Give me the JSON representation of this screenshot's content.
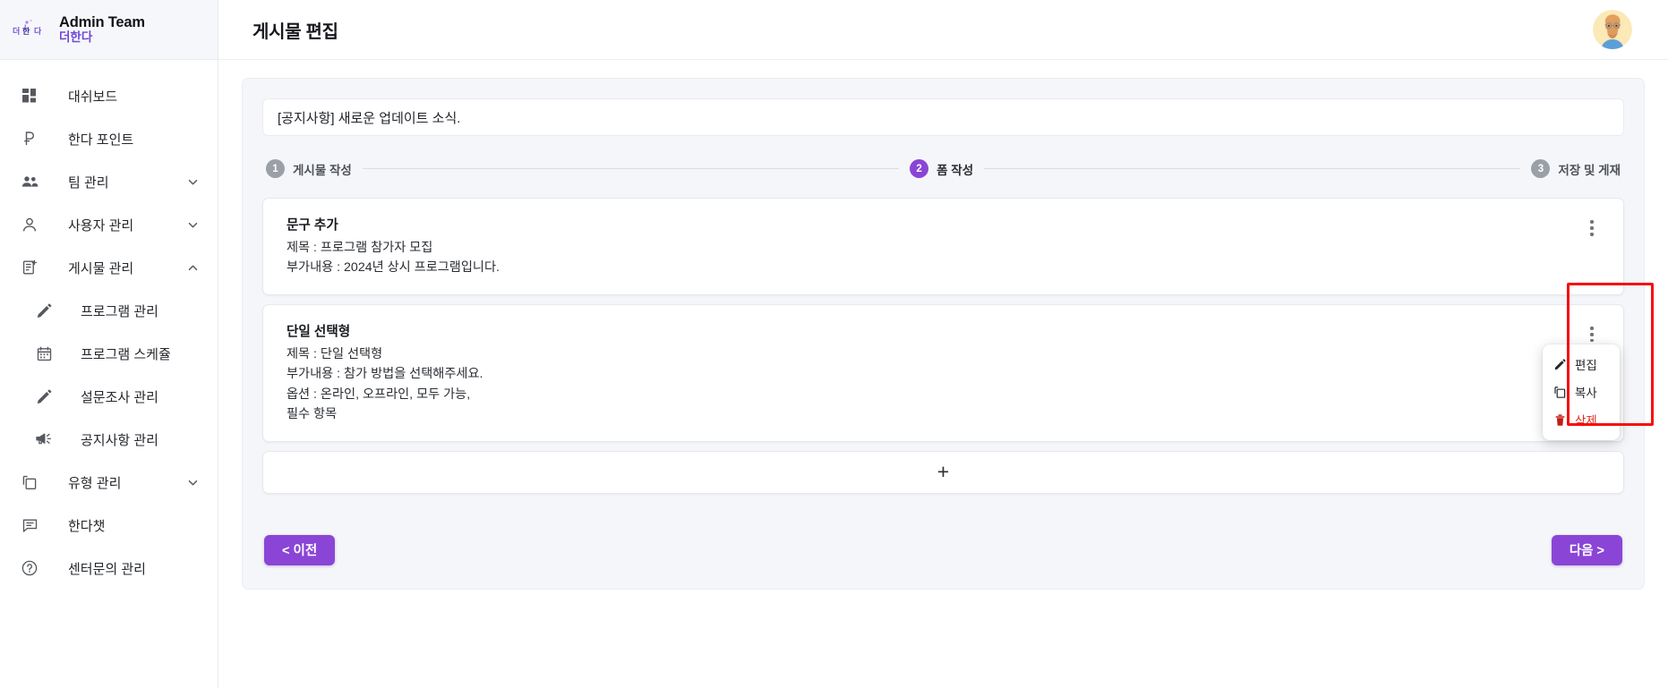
{
  "brand": {
    "logo_icon": "hanada-logo-icon",
    "title": "Admin Team",
    "subtitle": "더한다"
  },
  "sidebar": {
    "items": [
      {
        "label": "대쉬보드",
        "icon": "dashboard-grid-icon",
        "expandable": false,
        "sub": false
      },
      {
        "label": "한다 포인트",
        "icon": "point-currency-icon",
        "expandable": false,
        "sub": false
      },
      {
        "label": "팀 관리",
        "icon": "people-group-icon",
        "expandable": true,
        "sub": false
      },
      {
        "label": "사용자 관리",
        "icon": "person-icon",
        "expandable": true,
        "sub": false
      },
      {
        "label": "게시물 관리",
        "icon": "post-add-icon",
        "expandable": true,
        "expanded": true,
        "sub": false
      },
      {
        "label": "프로그램 관리",
        "icon": "pencil-icon",
        "expandable": false,
        "sub": true
      },
      {
        "label": "프로그램 스케쥴",
        "icon": "calendar-icon",
        "expandable": false,
        "sub": true
      },
      {
        "label": "설문조사 관리",
        "icon": "pencil-icon",
        "expandable": false,
        "sub": true
      },
      {
        "label": "공지사항 관리",
        "icon": "megaphone-icon",
        "expandable": false,
        "sub": true
      },
      {
        "label": "유형 관리",
        "icon": "copy-layers-icon",
        "expandable": true,
        "sub": false
      },
      {
        "label": "한다챗",
        "icon": "chat-bubble-icon",
        "expandable": false,
        "sub": false
      },
      {
        "label": "센터문의 관리",
        "icon": "help-circle-icon",
        "expandable": false,
        "sub": false
      }
    ]
  },
  "header": {
    "title": "게시물 편집",
    "avatar_icon": "user-avatar"
  },
  "notice": {
    "text": "[공지사항] 새로운 업데이트 소식."
  },
  "stepper": {
    "steps": [
      {
        "number": "1",
        "label": "게시물 작성",
        "active": false
      },
      {
        "number": "2",
        "label": "폼 작성",
        "active": true
      },
      {
        "number": "3",
        "label": "저장 및 게재",
        "active": false
      }
    ]
  },
  "cards": [
    {
      "title": "문구 추가",
      "lines": [
        "제목 : 프로그램 참가자 모집",
        "부가내용 : 2024년 상시 프로그램입니다."
      ],
      "menu_open": false
    },
    {
      "title": "단일 선택형",
      "lines": [
        "제목 : 단일 선택형",
        "부가내용 : 참가 방법을 선택해주세요.",
        "옵션 : 온라인,  오프라인,  모두 가능,",
        "필수 항목"
      ],
      "menu_open": true
    }
  ],
  "add_card": {
    "icon": "plus-icon",
    "label": "+"
  },
  "context_menu": {
    "items": [
      {
        "label": "편집",
        "icon": "pencil-icon",
        "danger": false
      },
      {
        "label": "복사",
        "icon": "copy-icon",
        "danger": false
      },
      {
        "label": "삭제",
        "icon": "trash-icon",
        "danger": true
      }
    ]
  },
  "footer": {
    "prev_label": "< 이전",
    "next_label": "다음 >"
  },
  "colors": {
    "accent": "#8b45d6",
    "brand_sub": "#6f49d8",
    "danger": "#e02b20",
    "highlight": "#f70d0d",
    "panel_bg": "#f5f6fa",
    "step_inactive": "#9b9fa6"
  }
}
